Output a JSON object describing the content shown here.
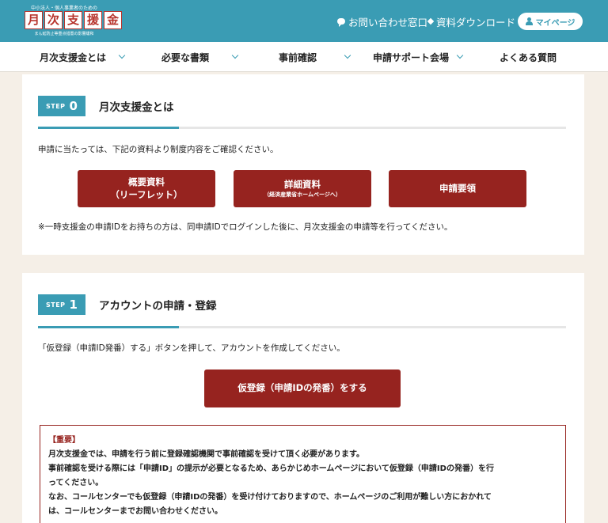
{
  "header": {
    "logo_tagline": "中小法人・個人事業者のための",
    "logo_chars": [
      "月",
      "次",
      "支",
      "援",
      "金"
    ],
    "logo_subline": "まん延防止等重点措置の影響緩和",
    "contact_label": "お問い合わせ窓口",
    "download_label": "資料ダウンロード",
    "mypage_label": "マイページ",
    "brand_color": "#3a9cb4"
  },
  "nav": {
    "items": [
      {
        "label": "月次支援金とは"
      },
      {
        "label": "必要な書類"
      },
      {
        "label": "事前確認"
      },
      {
        "label": "申請サポート会場"
      },
      {
        "label": "よくある質問"
      }
    ]
  },
  "step0": {
    "step_word": "STEP",
    "step_num": "0",
    "title": "月次支援金とは",
    "intro": "申請に当たっては、下記の資料より制度内容をご確認ください。",
    "buttons": [
      {
        "line1": "概要資料",
        "line2": "（リーフレット）"
      },
      {
        "line1": "詳細資料",
        "line2": "（経済産業省ホームページへ）"
      },
      {
        "line1": "申請要領"
      }
    ],
    "note": "※一時支援金の申請IDをお持ちの方は、同申請IDでログインした後に、月次支援金の申請等を行ってください。"
  },
  "step1": {
    "step_word": "STEP",
    "step_num": "1",
    "title": "アカウントの申請・登録",
    "intro": "「仮登録（申請ID発番）する」ボタンを押して、アカウントを作成してください。",
    "register_button": "仮登録（申請IDの発番）をする",
    "notice": {
      "label": "【重要】",
      "lines": [
        "月次支援金では、申請を行う前に登録確認機関で事前確認を受けて頂く必要があります。",
        "事前確認を受ける際には「申請ID」の提示が必要となるため、あらかじめホームページにおいて仮登録（申請IDの発番）を行",
        "ってください。",
        "なお、コールセンターでも仮登録（申請IDの発番）を受け付けておりますので、ホームページのご利用が難しい方におかれて",
        "は、コールセンターまでお問い合わせください。"
      ]
    },
    "accent_color": "#96231f"
  }
}
